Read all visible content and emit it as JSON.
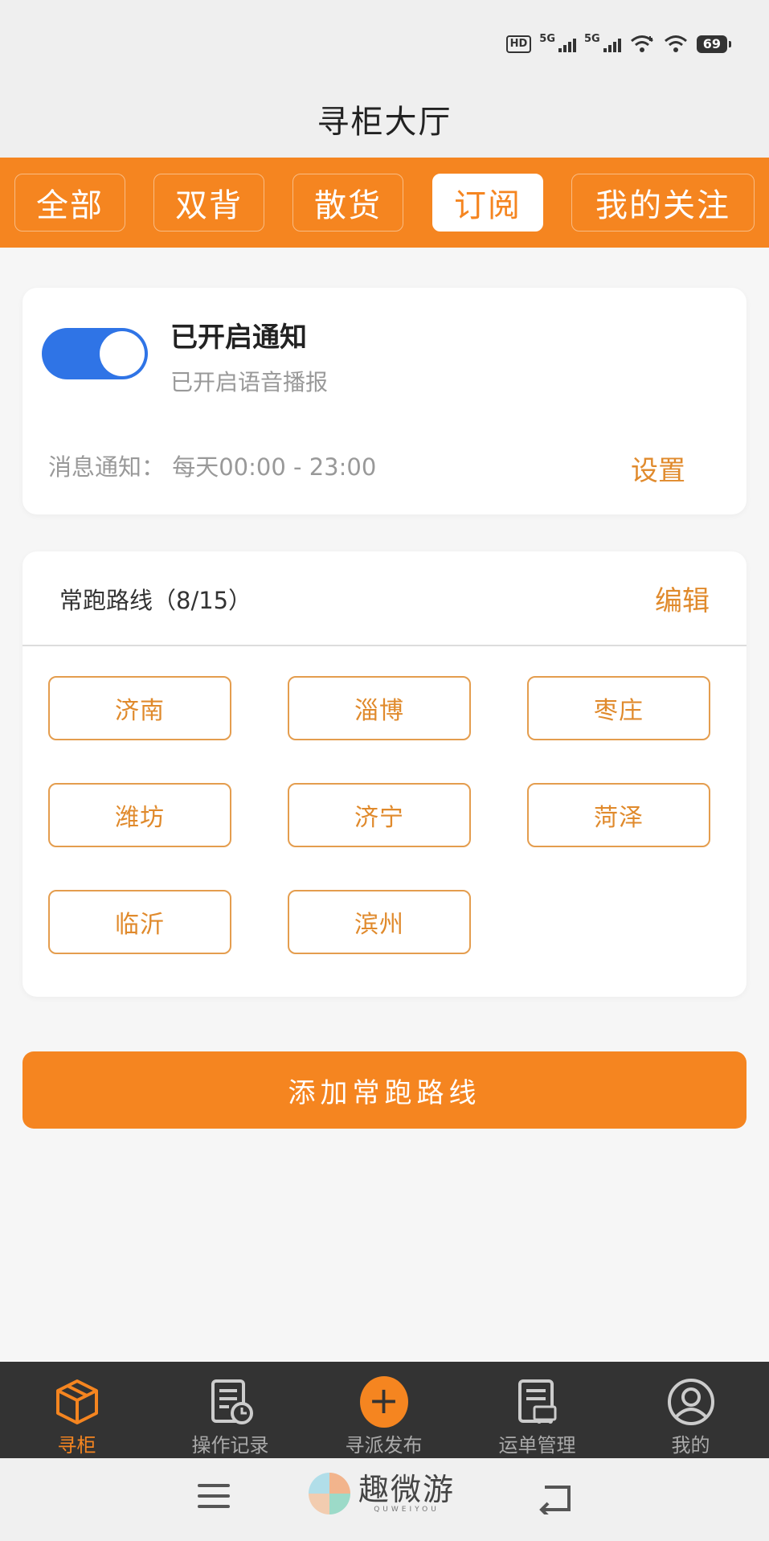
{
  "status": {
    "hd": "HD",
    "net1": "5G",
    "net2": "5G",
    "battery": "69"
  },
  "header": {
    "title": "寻柜大厅"
  },
  "tabs": [
    {
      "label": "全部",
      "active": false
    },
    {
      "label": "双背",
      "active": false
    },
    {
      "label": "散货",
      "active": false
    },
    {
      "label": "订阅",
      "active": true
    },
    {
      "label": "我的关注",
      "active": false
    }
  ],
  "notification": {
    "enabled": true,
    "title": "已开启通知",
    "subtitle": "已开启语音播报",
    "time_label": "消息通知：",
    "time_range": "每天00:00 - 23:00",
    "settings_label": "设置"
  },
  "routes": {
    "header": "常跑路线（8/15）",
    "edit_label": "编辑",
    "items": [
      "济南",
      "淄博",
      "枣庄",
      "潍坊",
      "济宁",
      "菏泽",
      "临沂",
      "滨州"
    ]
  },
  "add_route_label": "添加常跑路线",
  "bottom_nav": [
    {
      "label": "寻柜",
      "icon": "box-icon",
      "active": true
    },
    {
      "label": "操作记录",
      "icon": "record-icon",
      "active": false
    },
    {
      "label": "寻派发布",
      "icon": "plus-icon",
      "active": false
    },
    {
      "label": "运单管理",
      "icon": "waybill-icon",
      "active": false
    },
    {
      "label": "我的",
      "icon": "user-icon",
      "active": false
    }
  ],
  "watermark": {
    "text": "趣微游",
    "sub": "QUWEIYOU"
  },
  "colors": {
    "accent": "#f58520",
    "toggle": "#2f74e6",
    "nav_bg": "#333333"
  }
}
